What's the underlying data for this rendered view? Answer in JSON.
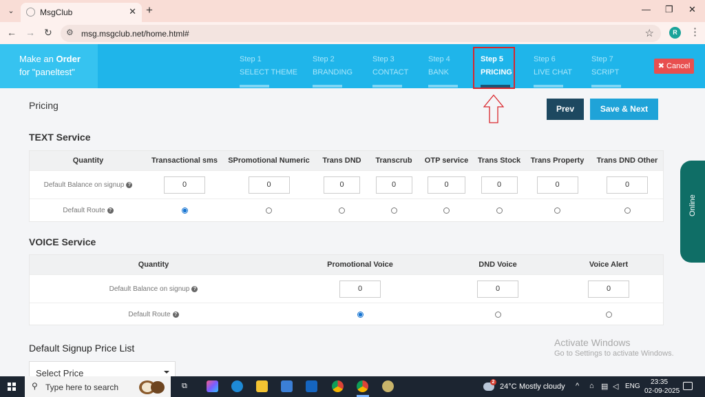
{
  "browser": {
    "tab_title": "MsgClub",
    "url": "msg.msgclub.net/home.html#",
    "profile_initial": "R"
  },
  "header": {
    "order_line1_prefix": "Make an ",
    "order_line1_bold": "Order",
    "order_line2": "for \"paneltest\"",
    "steps": [
      {
        "num": "Step 1",
        "label": "SELECT THEME"
      },
      {
        "num": "Step 2",
        "label": "BRANDING"
      },
      {
        "num": "Step 3",
        "label": "CONTACT"
      },
      {
        "num": "Step 4",
        "label": "BANK"
      },
      {
        "num": "Step 5",
        "label": "PRICING"
      },
      {
        "num": "Step 6",
        "label": "LIVE CHAT"
      },
      {
        "num": "Step 7",
        "label": "SCRIPT"
      }
    ],
    "active_step": 5,
    "cancel_label": "Cancel"
  },
  "page": {
    "title": "Pricing",
    "prev_label": "Prev",
    "save_next_label": "Save & Next"
  },
  "text_service": {
    "title": "TEXT Service",
    "columns": [
      "Quantity",
      "Transactional sms",
      "SPromotional Numeric",
      "Trans DND",
      "Transcrub",
      "OTP service",
      "Trans Stock",
      "Trans Property",
      "Trans DND Other"
    ],
    "balance_label": "Default Balance on signup",
    "route_label": "Default Route",
    "balances": [
      "0",
      "0",
      "0",
      "0",
      "0",
      "0",
      "0",
      "0"
    ],
    "selected_route": 0
  },
  "voice_service": {
    "title": "VOICE Service",
    "columns": [
      "Quantity",
      "Promotional Voice",
      "DND Voice",
      "Voice Alert"
    ],
    "balance_label": "Default Balance on signup",
    "route_label": "Default Route",
    "balances": [
      "0",
      "0",
      "0"
    ],
    "selected_route": 0
  },
  "signup_price": {
    "title": "Default Signup Price List",
    "select_value": "Select Price"
  },
  "online_label": "Online",
  "watermark": {
    "line1": "Activate Windows",
    "line2": "Go to Settings to activate Windows."
  },
  "taskbar": {
    "search_placeholder": "Type here to search",
    "weather_badge": "2",
    "temperature": "24°C",
    "weather": "Mostly cloudy",
    "language": "ENG",
    "time": "23:35",
    "date": "02-09-2025"
  }
}
